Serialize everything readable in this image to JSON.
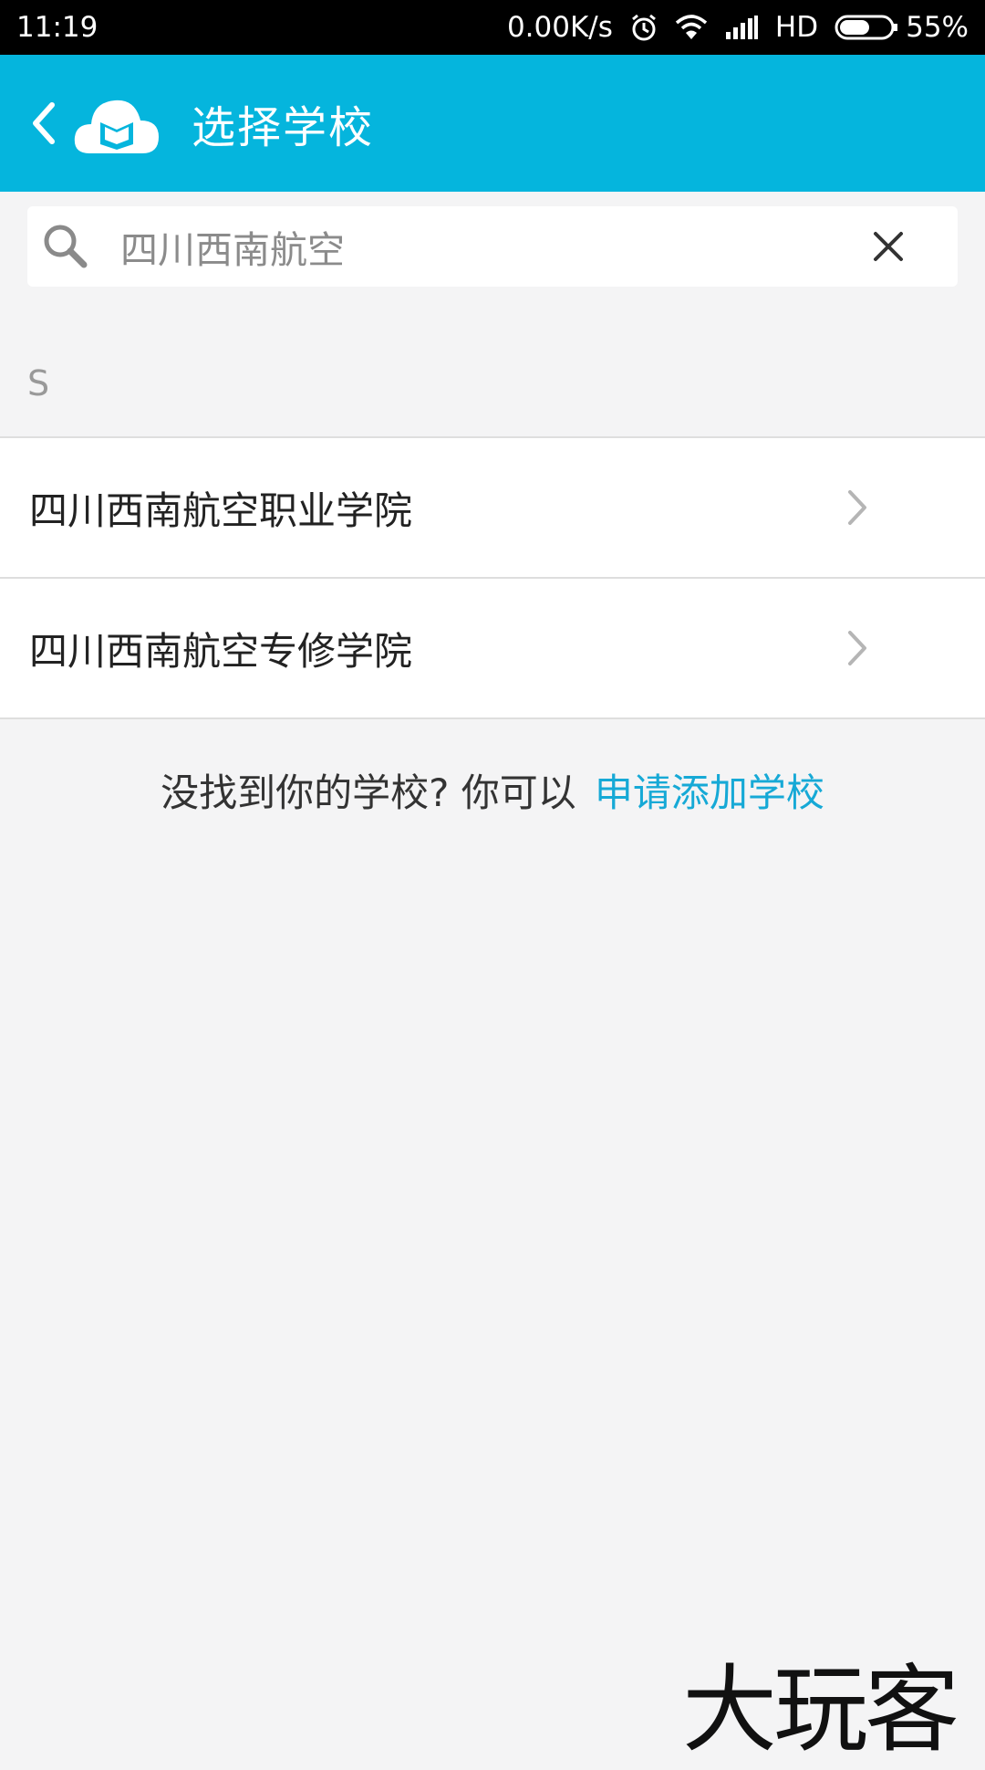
{
  "status_bar": {
    "time": "11:19",
    "net_speed": "0.00K/s",
    "network": "HD",
    "battery": "55%"
  },
  "app_bar": {
    "title": "选择学校",
    "accent_color": "#05b5dd"
  },
  "search": {
    "value": "四川西南航空"
  },
  "section": {
    "letter": "S"
  },
  "results": [
    {
      "label": "四川西南航空职业学院"
    },
    {
      "label": "四川西南航空专修学院"
    }
  ],
  "footer": {
    "prefix": "没找到你的学校? 你可以",
    "link": "申请添加学校",
    "link_color": "#16a9d6"
  },
  "watermark": {
    "text": "大玩客"
  },
  "icons": [
    "alarm-icon",
    "wifi-icon",
    "signal-icon",
    "battery-icon",
    "back-icon",
    "app-logo-icon",
    "search-icon",
    "clear-icon",
    "chevron-right-icon"
  ]
}
